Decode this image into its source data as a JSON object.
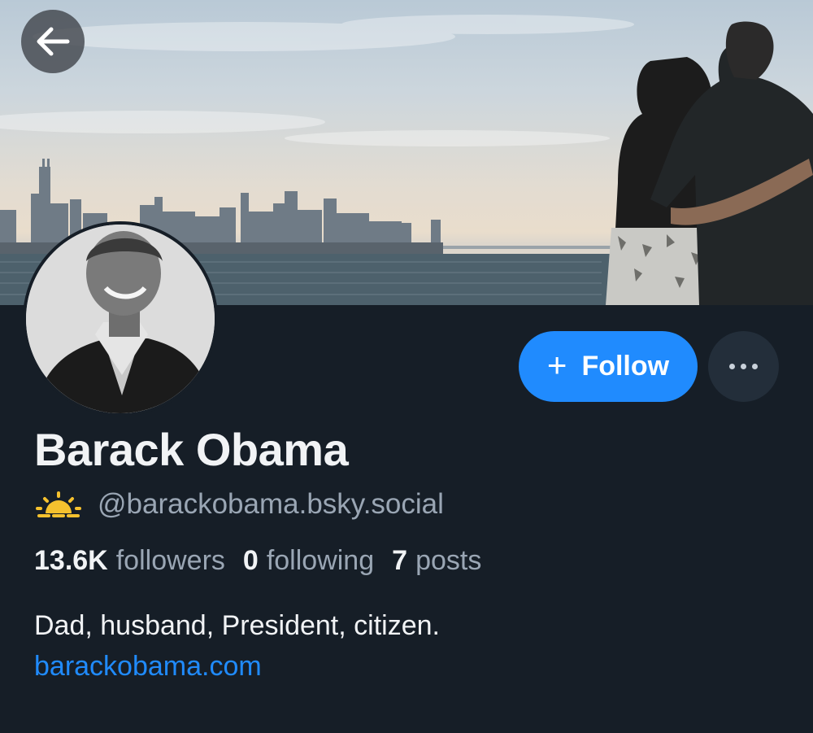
{
  "header": {
    "back_icon": "arrow-left-icon",
    "banner_description_icon": "banner-image"
  },
  "profile": {
    "display_name": "Barack Obama",
    "handle": "@barackobama.bsky.social",
    "handle_icon": "sun-icon",
    "bio": "Dad, husband, President, citizen.",
    "website": "barackobama.com"
  },
  "actions": {
    "follow_plus": "+",
    "follow_label": "Follow",
    "more_icon": "ellipsis-icon"
  },
  "stats": {
    "followers_count": "13.6K",
    "followers_label": "followers",
    "following_count": "0",
    "following_label": "following",
    "posts_count": "7",
    "posts_label": "posts"
  },
  "colors": {
    "background": "#161e27",
    "accent": "#208bfe",
    "muted_text": "#9aa6b4",
    "primary_text": "#f1f3f5",
    "sun_icon": "#f5c12e"
  }
}
